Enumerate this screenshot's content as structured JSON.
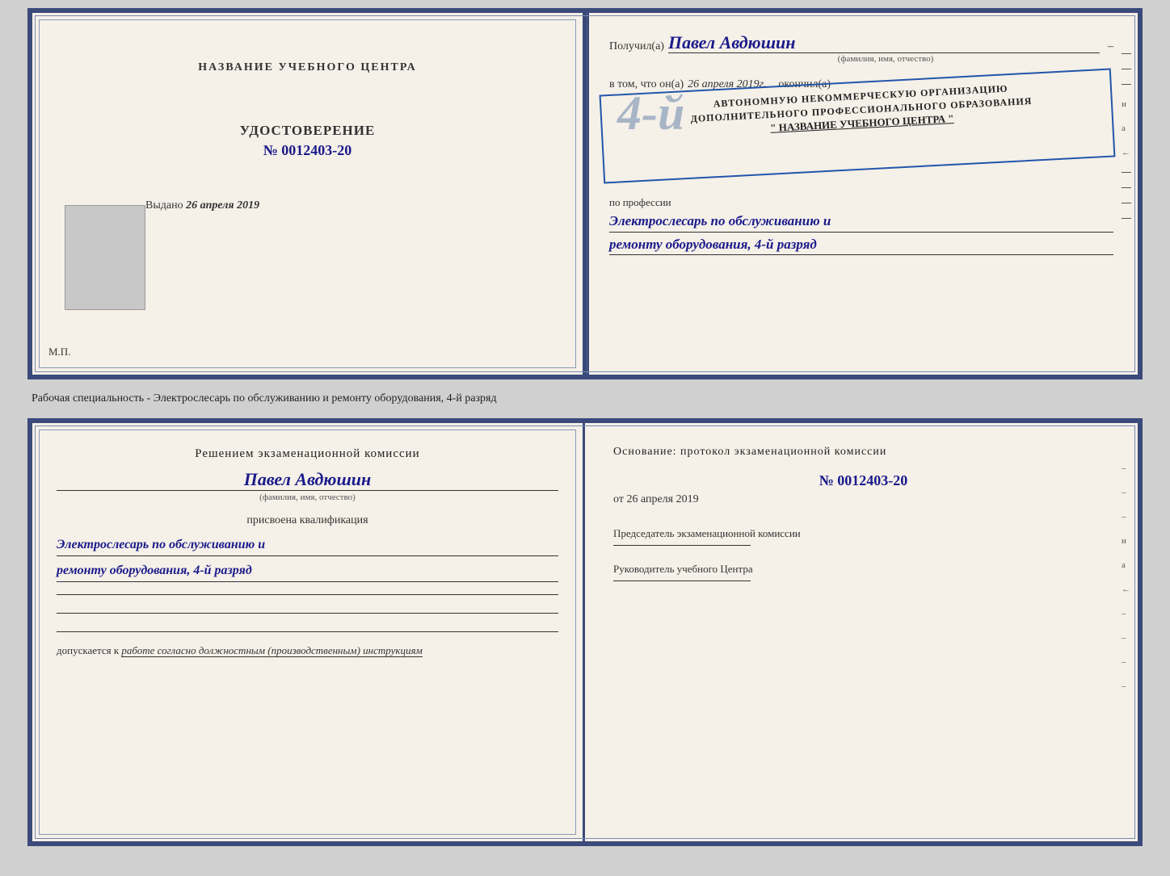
{
  "top_left": {
    "center_name": "НАЗВАНИЕ УЧЕБНОГО ЦЕНТРА",
    "doc_type": "УДОСТОВЕРЕНИЕ",
    "doc_number": "№ 0012403-20",
    "issued_label": "Выдано",
    "issued_date": "26 апреля 2019",
    "mp_label": "М.П."
  },
  "top_right": {
    "received_label": "Получил(а)",
    "recipient_name": "Павел Авдюшин",
    "fio_hint": "(фамилия, имя, отчество)",
    "vtom_label": "в том, что он(а)",
    "date_italic": "26 апреля 2019г.",
    "okonchil_label": "окончил(а)",
    "stamp_line1": "АВТОНОМНУЮ НЕКОММЕРЧЕСКУЮ ОРГАНИЗАЦИЮ",
    "stamp_line2": "ДОПОЛНИТЕЛЬНОГО ПРОФЕССИОНАЛЬНОГО ОБРАЗОВАНИЯ",
    "stamp_line3": "\" НАЗВАНИЕ УЧЕБНОГО ЦЕНТРА \"",
    "profession_label": "по профессии",
    "profession_text1": "Электрослесарь по обслуживанию и",
    "profession_text2": "ремонту оборудования, 4-й разряд"
  },
  "middle": {
    "text": "Рабочая специальность - Электрослесарь по обслуживанию и ремонту оборудования, 4-й разряд"
  },
  "bottom_left": {
    "decision_title": "Решением экзаменационной комиссии",
    "person_name": "Павел Авдюшин",
    "fio_hint": "(фамилия, имя, отчество)",
    "assigned_label": "присвоена квалификация",
    "qualification_text1": "Электрослесарь по обслуживанию и",
    "qualification_text2": "ремонту оборудования, 4-й разряд",
    "допускается_label": "допускается к",
    "допускается_text": "работе согласно должностным (производственным) инструкциям"
  },
  "bottom_right": {
    "osnование_label": "Основание: протокол экзаменационной  комиссии",
    "number": "№  0012403-20",
    "date_label": "от",
    "date_value": "26 апреля 2019",
    "chairman_title": "Председатель экзаменационной комиссии",
    "rukovoditel_title": "Руководитель учебного Центра"
  },
  "right_dashes": [
    "–",
    "–",
    "–",
    "и",
    "а",
    "←",
    "–",
    "–",
    "–",
    "–"
  ],
  "colors": {
    "border": "#3a4a7a",
    "blue_ink": "#1a1a8a",
    "stamp_blue": "#2255aa"
  }
}
